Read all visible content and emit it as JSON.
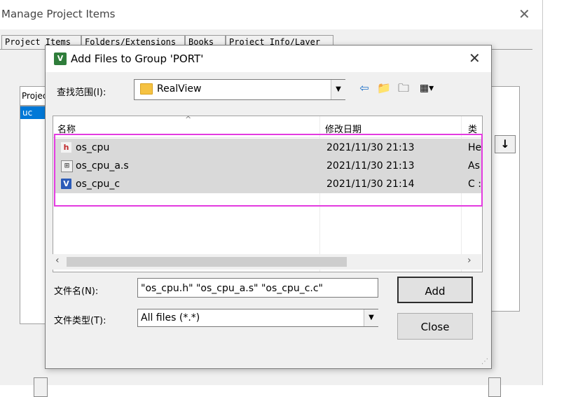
{
  "background_window": {
    "title": "Manage Project Items",
    "tabs": [
      "Project Items",
      "Folders/Extensions",
      "Books",
      "Project Info/Layer"
    ],
    "group_label": "Projec",
    "list_item": "uc"
  },
  "dialog": {
    "title": "Add Files to Group 'PORT'",
    "app_icon": "V",
    "look_in_label": "查找范围(I):",
    "look_in_value": "RealView",
    "toolbar_icons": [
      "back-arrow-icon",
      "up-folder-icon",
      "new-folder-icon",
      "view-menu-icon"
    ],
    "columns": [
      "名称",
      "修改日期",
      "类"
    ],
    "files": [
      {
        "name": "os_cpu",
        "date": "2021/11/30 21:13",
        "type": "He",
        "icon": "h-file-icon"
      },
      {
        "name": "os_cpu_a.s",
        "date": "2021/11/30 21:13",
        "type": "As",
        "icon": "asm-file-icon"
      },
      {
        "name": "os_cpu_c",
        "date": "2021/11/30 21:14",
        "type": "C :",
        "icon": "c-file-icon"
      }
    ],
    "filename_label": "文件名(N):",
    "filename_value": "\"os_cpu.h\" \"os_cpu_a.s\" \"os_cpu_c.c\"",
    "filetype_label": "文件类型(T):",
    "filetype_value": "All files (*.*)",
    "add_button": "Add",
    "close_button": "Close"
  },
  "colors": {
    "highlight_box": "#e33be0",
    "selected_row": "#d9d9d9",
    "list_selection": "#0078d7"
  }
}
